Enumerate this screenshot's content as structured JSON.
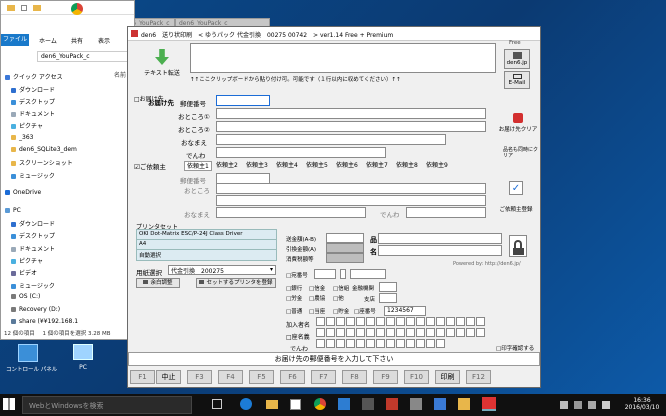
{
  "explorer": {
    "tabs": [
      "ファイル",
      "ホーム",
      "共有",
      "表示"
    ],
    "path": "den6_YouPack_c",
    "column_header": "名前",
    "quick_access": "クイック アクセス",
    "items": [
      "ダウンロード",
      "デスクトップ",
      "ドキュメント",
      "ピクチャ",
      "_363",
      "den6_SQLite3_dem",
      "スクリーンショット",
      "ミュージック"
    ],
    "onedrive": "OneDrive",
    "pc": "PC",
    "pc_items": [
      "ダウンロード",
      "デスクトップ",
      "ドキュメント",
      "ピクチャ",
      "ビデオ",
      "ミュージック",
      "OS (C:)",
      "Recovery (D:)",
      "share (¥¥192.168.1"
    ],
    "status_count": "12 個の項目",
    "status_selected": "1 個の項目を選択 3.28 MB"
  },
  "browser": {
    "tab1": "den6_YouPack_c",
    "tab2": "den6_YouPack_c"
  },
  "desktop": {
    "icon1": "コントロール パネル",
    "icon2": "PC"
  },
  "app": {
    "title": "den6　送り状印刷　< ゆうパック 代金引換　00275 00742　> ver1.14 Free + Premium",
    "free_label": "Free",
    "site_label": "den6.jp",
    "email_label": "E-Mail",
    "text_transfer": "テキスト転送",
    "hint": "↑↑ここクリップボードから貼り付け可。可能です（１行以内に収めてください）↑↑",
    "recipient_check": "□お届け先",
    "recipient_label": "お届け先",
    "postal_label": "郵便番号",
    "address1": "おところ①",
    "address2": "おところ②",
    "name_label": "おなまえ",
    "phone_label": "でんわ",
    "clear_label": "お届け先クリア",
    "clear_sub": "品名も同時にクリア",
    "shipper_check": "☑ご依頼主",
    "shipper_tabs": [
      "依頼主1",
      "依頼主2",
      "依頼主3",
      "依頼主4",
      "依頼主5",
      "依頼主6",
      "依頼主7",
      "依頼主8",
      "依頼主9"
    ],
    "shipper_postal": "郵便番号",
    "shipper_address": "おところ",
    "shipper_name": "おなまえ",
    "shipper_phone": "でんわ",
    "shipper_register": "ご依頼主登録",
    "printer_section": "プリンタセット",
    "printer_name": "OKI Dot-Matrix ESC/P-24J Class Driver",
    "paper": "A4",
    "mode": "自動選択",
    "paper_select_label": "用紙選択",
    "paper_select_value": "代金引換　200275",
    "adjust_btn": "余白調整",
    "register_btn": "セットするプリンタを登録",
    "cod_label": "送金額(A-B)",
    "fee_label": "引換金額(A)",
    "tax_label": "消費税額等",
    "item_label": "品",
    "name2_label": "名",
    "powered": "Powered by: http://den6.jp/",
    "pickup_label": "□宛番号",
    "bank_options": [
      "□銀行",
      "□信金",
      "□信組",
      "□労金",
      "□農協",
      "□他"
    ],
    "bank_label": "金融機関",
    "branch_label": "支店",
    "account_types": [
      "□普通",
      "□当座",
      "□貯金"
    ],
    "account_label": "□座番号",
    "account_number": "1234567",
    "member_label": "加入者名",
    "holder_label": "□座名義",
    "tel_label": "でんわ",
    "print_confirm": "□印字確認する",
    "status_message": "お届け先の郵便番号を入力して下さい",
    "fkeys": [
      "F1",
      "中止",
      "F3",
      "F4",
      "F5",
      "F6",
      "F7",
      "F8",
      "F9",
      "F10",
      "印刷",
      "F12"
    ]
  },
  "taskbar": {
    "search": "WebとWindowsを検索",
    "time": "16:36",
    "date": "2016/03/10"
  }
}
